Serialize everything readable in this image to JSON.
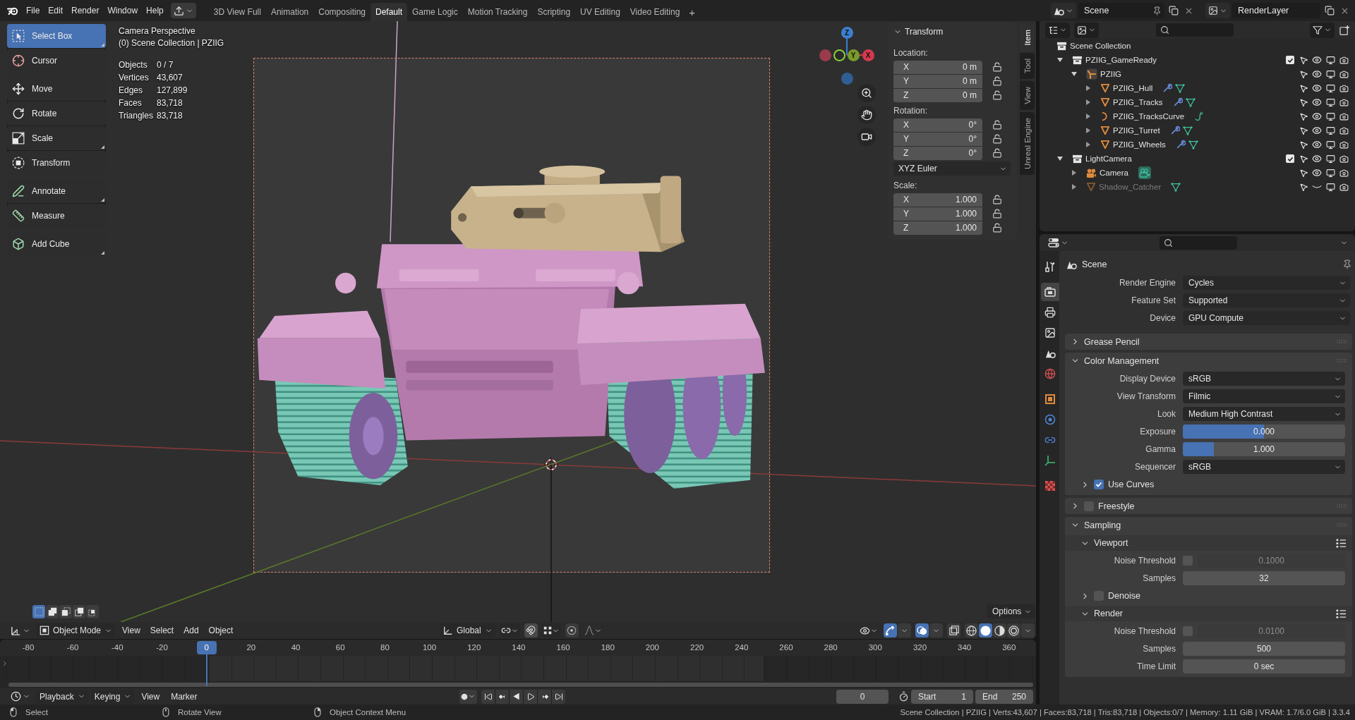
{
  "top_bar": {
    "menus": [
      "File",
      "Edit",
      "Render",
      "Window",
      "Help"
    ],
    "workspaces": [
      {
        "label": "3D View Full",
        "selected": false
      },
      {
        "label": "Animation",
        "selected": false
      },
      {
        "label": "Compositing",
        "selected": false
      },
      {
        "label": "Default",
        "selected": true
      },
      {
        "label": "Game Logic",
        "selected": false
      },
      {
        "label": "Motion Tracking",
        "selected": false
      },
      {
        "label": "Scripting",
        "selected": false
      },
      {
        "label": "UV Editing",
        "selected": false
      },
      {
        "label": "Video Editing",
        "selected": false
      }
    ],
    "add_tab": "+",
    "scene": "Scene",
    "view_layer": "RenderLayer"
  },
  "viewport": {
    "view_name": "Camera Perspective",
    "collection_path": "(0) Scene Collection | PZIIG",
    "stats": [
      {
        "label": "Objects",
        "value": "0 / 7"
      },
      {
        "label": "Vertices",
        "value": "43,607"
      },
      {
        "label": "Edges",
        "value": "127,899"
      },
      {
        "label": "Faces",
        "value": "83,718"
      },
      {
        "label": "Triangles",
        "value": "83,718"
      }
    ],
    "tool_groups": [
      {
        "tools": [
          {
            "label": "Select Box",
            "selected": true,
            "more": true
          },
          {
            "label": "Cursor",
            "selected": false,
            "more": false
          }
        ]
      },
      {
        "tools": [
          {
            "label": "Move",
            "selected": false,
            "more": false
          },
          {
            "label": "Rotate",
            "selected": false,
            "more": false
          },
          {
            "label": "Scale",
            "selected": false,
            "more": true
          },
          {
            "label": "Transform",
            "selected": false,
            "more": false
          }
        ]
      },
      {
        "tools": [
          {
            "label": "Annotate",
            "selected": false,
            "more": true
          },
          {
            "label": "Measure",
            "selected": false,
            "more": false
          }
        ]
      },
      {
        "tools": [
          {
            "label": "Add Cube",
            "selected": false,
            "more": true
          }
        ]
      }
    ],
    "gizmo_axes": [
      "Z",
      "Y",
      "X"
    ],
    "selection_modes": [
      {
        "selected": true
      },
      {
        "selected": false
      },
      {
        "selected": false
      },
      {
        "selected": false
      },
      {
        "selected": false
      }
    ],
    "options": "Options"
  },
  "sidebar": {
    "title": "Transform",
    "groups": [
      {
        "label": "Location:",
        "fields": [
          {
            "axis": "X",
            "value": "0 m",
            "locked": false
          },
          {
            "axis": "Y",
            "value": "0 m",
            "locked": false
          },
          {
            "axis": "Z",
            "value": "0 m",
            "locked": false
          }
        ]
      },
      {
        "label": "Rotation:",
        "fields": [
          {
            "axis": "X",
            "value": "0°",
            "locked": false
          },
          {
            "axis": "Y",
            "value": "0°",
            "locked": false
          },
          {
            "axis": "Z",
            "value": "0°",
            "locked": false
          }
        ],
        "mode": "XYZ Euler"
      },
      {
        "label": "Scale:",
        "fields": [
          {
            "axis": "X",
            "value": "1.000",
            "locked": false
          },
          {
            "axis": "Y",
            "value": "1.000",
            "locked": false
          },
          {
            "axis": "Z",
            "value": "1.000",
            "locked": false
          }
        ]
      }
    ],
    "tabs": [
      {
        "label": "Item",
        "selected": true
      },
      {
        "label": "Tool",
        "selected": false
      },
      {
        "label": "View",
        "selected": false
      },
      {
        "label": "Unreal Engine",
        "selected": false
      }
    ]
  },
  "viewport_header": {
    "mode": "Object Mode",
    "menus": [
      "View",
      "Select",
      "Add",
      "Object"
    ],
    "orientation": "Global",
    "gizmos": true,
    "overlays": true,
    "xray": false,
    "shading": [
      {
        "selected": false
      },
      {
        "selected": true
      },
      {
        "selected": false
      },
      {
        "selected": false
      }
    ]
  },
  "timeline": {
    "ticks": [
      "-80",
      "-60",
      "-40",
      "-20",
      "20",
      "40",
      "60",
      "80",
      "100",
      "120",
      "140",
      "160",
      "180",
      "200",
      "220",
      "240",
      "260",
      "280",
      "300",
      "320",
      "340",
      "360"
    ],
    "playhead": "0",
    "playback": "Playback",
    "keying": "Keying",
    "menus": [
      "View",
      "Marker"
    ],
    "current_frame": "0",
    "start_label": "Start",
    "start": "1",
    "end_label": "End",
    "end": "250"
  },
  "outliner": {
    "tree": [
      {
        "name": "Scene Collection",
        "kind": "scene-collection",
        "children": [
          {
            "name": "PZIIG_GameReady",
            "kind": "collection",
            "expanded": true,
            "checked": true,
            "visible": true,
            "children": [
              {
                "name": "PZIIG",
                "kind": "armature",
                "expanded": true,
                "visible": true,
                "children": [
                  {
                    "name": "PZIIG_Hull",
                    "kind": "mesh",
                    "expanded": false,
                    "modifiers": true,
                    "visible": true
                  },
                  {
                    "name": "PZIIG_Tracks",
                    "kind": "mesh",
                    "expanded": false,
                    "modifiers": true,
                    "visible": true
                  },
                  {
                    "name": "PZIIG_TracksCurve",
                    "kind": "curve",
                    "expanded": false,
                    "visible": true
                  },
                  {
                    "name": "PZIIG_Turret",
                    "kind": "mesh",
                    "expanded": false,
                    "modifiers": true,
                    "visible": true
                  },
                  {
                    "name": "PZIIG_Wheels",
                    "kind": "mesh",
                    "expanded": false,
                    "modifiers": true,
                    "visible": true
                  }
                ]
              }
            ]
          },
          {
            "name": "LightCamera",
            "kind": "collection",
            "expanded": true,
            "checked": true,
            "visible": true,
            "children": [
              {
                "name": "Camera",
                "kind": "camera",
                "expanded": false,
                "visible": true
              },
              {
                "name": "Shadow_Catcher",
                "kind": "mesh",
                "expanded": false,
                "modifiers": false,
                "visible": false
              }
            ]
          }
        ]
      }
    ]
  },
  "properties": {
    "tabs": [
      {
        "selected": false
      },
      {
        "selected": true
      },
      {
        "selected": false
      },
      {
        "selected": false
      },
      {
        "selected": false
      },
      {
        "selected": false
      },
      {
        "selected": false
      },
      {
        "selected": false
      },
      {
        "selected": false
      },
      {
        "selected": false
      },
      {
        "selected": false
      }
    ],
    "context": "Scene",
    "rows": [
      {
        "kind": "dropdown",
        "label": "Render Engine",
        "value": "Cycles"
      },
      {
        "kind": "dropdown",
        "label": "Feature Set",
        "value": "Supported"
      },
      {
        "kind": "dropdown",
        "label": "Device",
        "value": "GPU Compute"
      }
    ],
    "panels": [
      {
        "title": "Grease Pencil",
        "kind": "plain",
        "expanded": false
      },
      {
        "title": "Color Management",
        "kind": "plain",
        "expanded": true,
        "rows": [
          {
            "kind": "dropdown",
            "label": "Display Device",
            "value": "sRGB"
          },
          {
            "kind": "dropdown",
            "label": "View Transform",
            "value": "Filmic"
          },
          {
            "kind": "dropdown",
            "label": "Look",
            "value": "Medium High Contrast"
          },
          {
            "kind": "slider",
            "label": "Exposure",
            "value": "0.000",
            "level": 0.5
          },
          {
            "kind": "slider",
            "label": "Gamma",
            "value": "1.000",
            "level": 0.19
          },
          {
            "kind": "dropdown",
            "label": "Sequencer",
            "value": "sRGB"
          }
        ],
        "subpanels": [
          {
            "title": "Use Curves",
            "kind": "toggle",
            "checked": true,
            "expanded": false
          }
        ]
      },
      {
        "title": "Freestyle",
        "kind": "toggle",
        "checked": false,
        "expanded": false
      },
      {
        "title": "Sampling",
        "kind": "plain",
        "expanded": true,
        "subpanels": [
          {
            "title": "Viewport",
            "kind": "presets",
            "expanded": true,
            "rows": [
              {
                "kind": "check-number",
                "label": "Noise Threshold",
                "checked": false,
                "value": "0.1000"
              },
              {
                "kind": "number",
                "label": "Samples",
                "value": "32"
              }
            ]
          },
          {
            "title": "Denoise",
            "kind": "toggle",
            "checked": false,
            "expanded": false
          },
          {
            "title": "Render",
            "kind": "presets",
            "expanded": true,
            "rows": [
              {
                "kind": "check-number",
                "label": "Noise Threshold",
                "checked": false,
                "value": "0.0100"
              },
              {
                "kind": "number",
                "label": "Samples",
                "value": "500"
              },
              {
                "kind": "number",
                "label": "Time Limit",
                "value": "0 sec"
              }
            ]
          }
        ]
      }
    ]
  },
  "status_bar": {
    "hints": [
      "Select",
      "Rotate View",
      "Object Context Menu"
    ],
    "info": "Scene Collection | PZIIG | Verts:43,607 | Faces:83,718 | Tris:83,718 | Objects:0/7 | Memory: 1.11 GiB | VRAM: 1.7/6.0 GiB | 3.3.4"
  }
}
